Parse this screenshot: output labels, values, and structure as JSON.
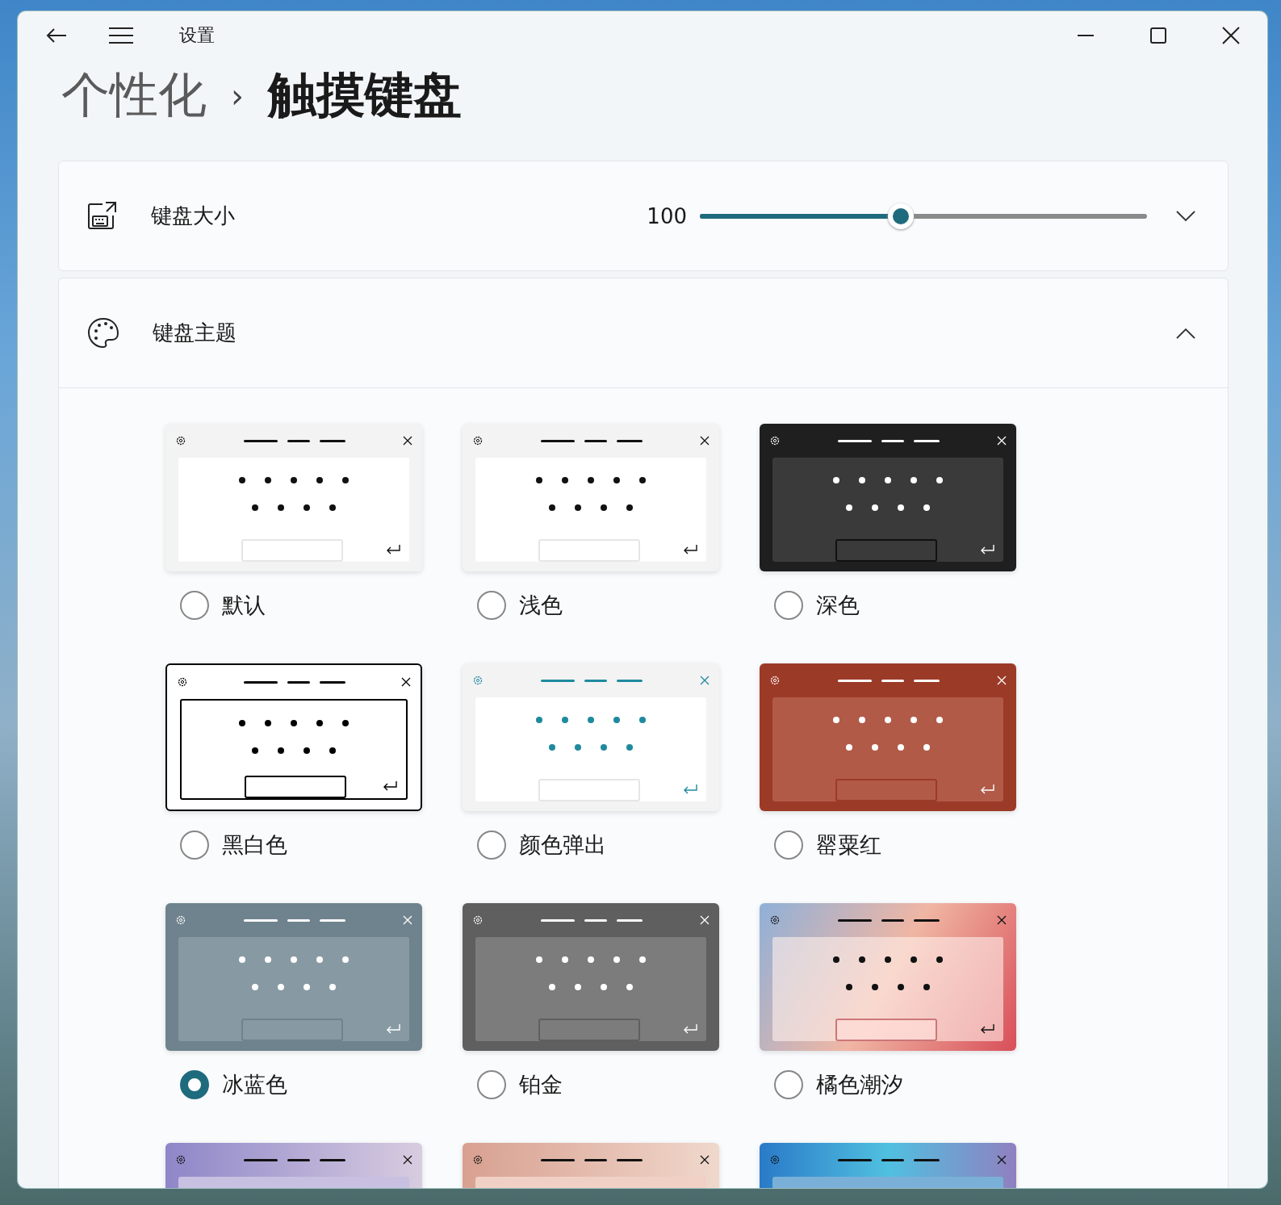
{
  "window": {
    "title": "设置"
  },
  "breadcrumb": {
    "parent": "个性化",
    "separator": "›",
    "current": "触摸键盘"
  },
  "keyboard_size": {
    "label": "键盘大小",
    "value": "100",
    "level": 0.45,
    "expanded": false
  },
  "keyboard_theme": {
    "label": "键盘主题",
    "expanded": true,
    "themes": [
      {
        "label": "默认",
        "selected": false,
        "kind": "default"
      },
      {
        "label": "浅色",
        "selected": false,
        "kind": "light"
      },
      {
        "label": "深色",
        "selected": false,
        "kind": "dark"
      },
      {
        "label": "黑白色",
        "selected": false,
        "kind": "contrast"
      },
      {
        "label": "颜色弹出",
        "selected": false,
        "kind": "popup"
      },
      {
        "label": "罂粟红",
        "selected": false,
        "kind": "poppy"
      },
      {
        "label": "冰蓝色",
        "selected": true,
        "kind": "iceblue"
      },
      {
        "label": "铂金",
        "selected": false,
        "kind": "platinum"
      },
      {
        "label": "橘色潮汐",
        "selected": false,
        "kind": "orange"
      },
      {
        "kind": "purple"
      },
      {
        "kind": "peach"
      },
      {
        "kind": "ocean"
      }
    ]
  }
}
